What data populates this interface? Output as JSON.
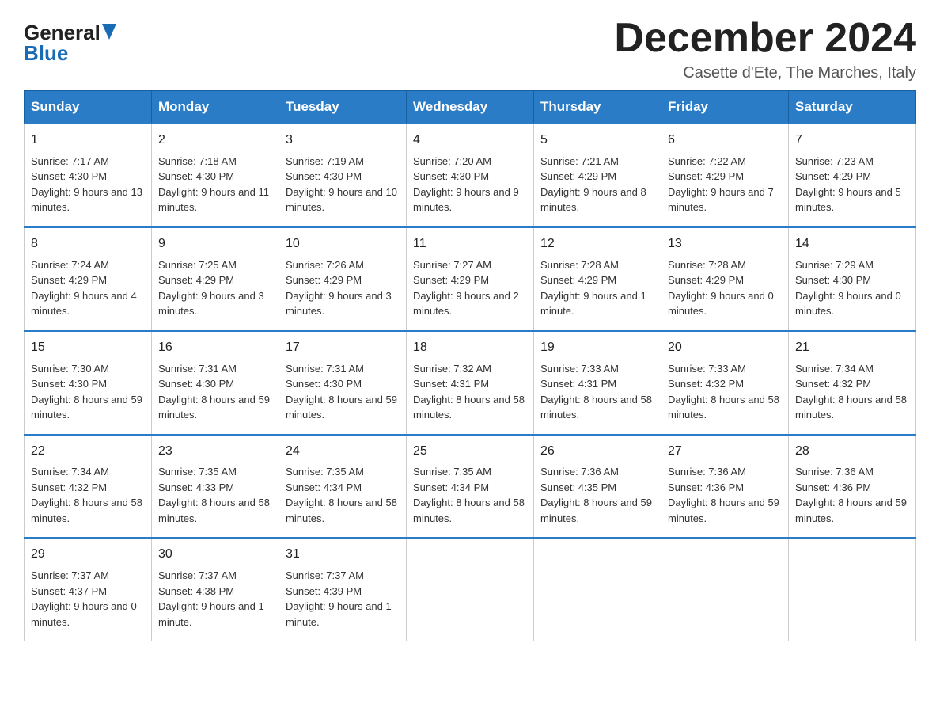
{
  "logo": {
    "general": "General",
    "blue": "Blue",
    "triangle": "▲"
  },
  "title": "December 2024",
  "subtitle": "Casette d'Ete, The Marches, Italy",
  "days_of_week": [
    "Sunday",
    "Monday",
    "Tuesday",
    "Wednesday",
    "Thursday",
    "Friday",
    "Saturday"
  ],
  "weeks": [
    [
      {
        "day": "1",
        "sunrise": "Sunrise: 7:17 AM",
        "sunset": "Sunset: 4:30 PM",
        "daylight": "Daylight: 9 hours and 13 minutes."
      },
      {
        "day": "2",
        "sunrise": "Sunrise: 7:18 AM",
        "sunset": "Sunset: 4:30 PM",
        "daylight": "Daylight: 9 hours and 11 minutes."
      },
      {
        "day": "3",
        "sunrise": "Sunrise: 7:19 AM",
        "sunset": "Sunset: 4:30 PM",
        "daylight": "Daylight: 9 hours and 10 minutes."
      },
      {
        "day": "4",
        "sunrise": "Sunrise: 7:20 AM",
        "sunset": "Sunset: 4:30 PM",
        "daylight": "Daylight: 9 hours and 9 minutes."
      },
      {
        "day": "5",
        "sunrise": "Sunrise: 7:21 AM",
        "sunset": "Sunset: 4:29 PM",
        "daylight": "Daylight: 9 hours and 8 minutes."
      },
      {
        "day": "6",
        "sunrise": "Sunrise: 7:22 AM",
        "sunset": "Sunset: 4:29 PM",
        "daylight": "Daylight: 9 hours and 7 minutes."
      },
      {
        "day": "7",
        "sunrise": "Sunrise: 7:23 AM",
        "sunset": "Sunset: 4:29 PM",
        "daylight": "Daylight: 9 hours and 5 minutes."
      }
    ],
    [
      {
        "day": "8",
        "sunrise": "Sunrise: 7:24 AM",
        "sunset": "Sunset: 4:29 PM",
        "daylight": "Daylight: 9 hours and 4 minutes."
      },
      {
        "day": "9",
        "sunrise": "Sunrise: 7:25 AM",
        "sunset": "Sunset: 4:29 PM",
        "daylight": "Daylight: 9 hours and 3 minutes."
      },
      {
        "day": "10",
        "sunrise": "Sunrise: 7:26 AM",
        "sunset": "Sunset: 4:29 PM",
        "daylight": "Daylight: 9 hours and 3 minutes."
      },
      {
        "day": "11",
        "sunrise": "Sunrise: 7:27 AM",
        "sunset": "Sunset: 4:29 PM",
        "daylight": "Daylight: 9 hours and 2 minutes."
      },
      {
        "day": "12",
        "sunrise": "Sunrise: 7:28 AM",
        "sunset": "Sunset: 4:29 PM",
        "daylight": "Daylight: 9 hours and 1 minute."
      },
      {
        "day": "13",
        "sunrise": "Sunrise: 7:28 AM",
        "sunset": "Sunset: 4:29 PM",
        "daylight": "Daylight: 9 hours and 0 minutes."
      },
      {
        "day": "14",
        "sunrise": "Sunrise: 7:29 AM",
        "sunset": "Sunset: 4:30 PM",
        "daylight": "Daylight: 9 hours and 0 minutes."
      }
    ],
    [
      {
        "day": "15",
        "sunrise": "Sunrise: 7:30 AM",
        "sunset": "Sunset: 4:30 PM",
        "daylight": "Daylight: 8 hours and 59 minutes."
      },
      {
        "day": "16",
        "sunrise": "Sunrise: 7:31 AM",
        "sunset": "Sunset: 4:30 PM",
        "daylight": "Daylight: 8 hours and 59 minutes."
      },
      {
        "day": "17",
        "sunrise": "Sunrise: 7:31 AM",
        "sunset": "Sunset: 4:30 PM",
        "daylight": "Daylight: 8 hours and 59 minutes."
      },
      {
        "day": "18",
        "sunrise": "Sunrise: 7:32 AM",
        "sunset": "Sunset: 4:31 PM",
        "daylight": "Daylight: 8 hours and 58 minutes."
      },
      {
        "day": "19",
        "sunrise": "Sunrise: 7:33 AM",
        "sunset": "Sunset: 4:31 PM",
        "daylight": "Daylight: 8 hours and 58 minutes."
      },
      {
        "day": "20",
        "sunrise": "Sunrise: 7:33 AM",
        "sunset": "Sunset: 4:32 PM",
        "daylight": "Daylight: 8 hours and 58 minutes."
      },
      {
        "day": "21",
        "sunrise": "Sunrise: 7:34 AM",
        "sunset": "Sunset: 4:32 PM",
        "daylight": "Daylight: 8 hours and 58 minutes."
      }
    ],
    [
      {
        "day": "22",
        "sunrise": "Sunrise: 7:34 AM",
        "sunset": "Sunset: 4:32 PM",
        "daylight": "Daylight: 8 hours and 58 minutes."
      },
      {
        "day": "23",
        "sunrise": "Sunrise: 7:35 AM",
        "sunset": "Sunset: 4:33 PM",
        "daylight": "Daylight: 8 hours and 58 minutes."
      },
      {
        "day": "24",
        "sunrise": "Sunrise: 7:35 AM",
        "sunset": "Sunset: 4:34 PM",
        "daylight": "Daylight: 8 hours and 58 minutes."
      },
      {
        "day": "25",
        "sunrise": "Sunrise: 7:35 AM",
        "sunset": "Sunset: 4:34 PM",
        "daylight": "Daylight: 8 hours and 58 minutes."
      },
      {
        "day": "26",
        "sunrise": "Sunrise: 7:36 AM",
        "sunset": "Sunset: 4:35 PM",
        "daylight": "Daylight: 8 hours and 59 minutes."
      },
      {
        "day": "27",
        "sunrise": "Sunrise: 7:36 AM",
        "sunset": "Sunset: 4:36 PM",
        "daylight": "Daylight: 8 hours and 59 minutes."
      },
      {
        "day": "28",
        "sunrise": "Sunrise: 7:36 AM",
        "sunset": "Sunset: 4:36 PM",
        "daylight": "Daylight: 8 hours and 59 minutes."
      }
    ],
    [
      {
        "day": "29",
        "sunrise": "Sunrise: 7:37 AM",
        "sunset": "Sunset: 4:37 PM",
        "daylight": "Daylight: 9 hours and 0 minutes."
      },
      {
        "day": "30",
        "sunrise": "Sunrise: 7:37 AM",
        "sunset": "Sunset: 4:38 PM",
        "daylight": "Daylight: 9 hours and 1 minute."
      },
      {
        "day": "31",
        "sunrise": "Sunrise: 7:37 AM",
        "sunset": "Sunset: 4:39 PM",
        "daylight": "Daylight: 9 hours and 1 minute."
      },
      null,
      null,
      null,
      null
    ]
  ]
}
